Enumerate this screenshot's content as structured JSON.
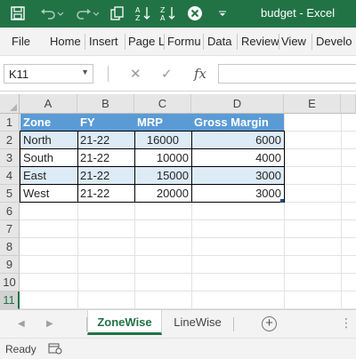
{
  "window": {
    "title": "budget  -  Excel"
  },
  "ribbon": {
    "tabs": [
      "File",
      "Home",
      "Insert",
      "Page L",
      "Formu",
      "Data",
      "Review",
      "View",
      "Develo"
    ]
  },
  "formula_bar": {
    "name_box": "K11",
    "formula": "",
    "fx_label": "fx"
  },
  "grid": {
    "columns": [
      "A",
      "B",
      "C",
      "D",
      "E"
    ],
    "rows": [
      "1",
      "2",
      "3",
      "4",
      "5",
      "6",
      "7",
      "8",
      "9",
      "10",
      "11"
    ],
    "selected_row": "11",
    "table": {
      "headers": [
        "Zone",
        "FY",
        "MRP",
        "Gross Margin"
      ],
      "rows": [
        [
          "North",
          "21-22",
          "16000",
          "6000"
        ],
        [
          "South",
          "21-22",
          "10000",
          "4000"
        ],
        [
          "East",
          "21-22",
          "15000",
          "3000"
        ],
        [
          "West",
          "21-22",
          "20000",
          "3000"
        ]
      ],
      "header_color": "#5B9BD5",
      "band_color": "#DDEBF7"
    }
  },
  "sheets": {
    "tabs": [
      "ZoneWise",
      "LineWise"
    ],
    "active": "ZoneWise"
  },
  "status_bar": {
    "status": "Ready"
  },
  "colors": {
    "accent": "#217346",
    "ribbon_bg": "#F3F3F3"
  }
}
